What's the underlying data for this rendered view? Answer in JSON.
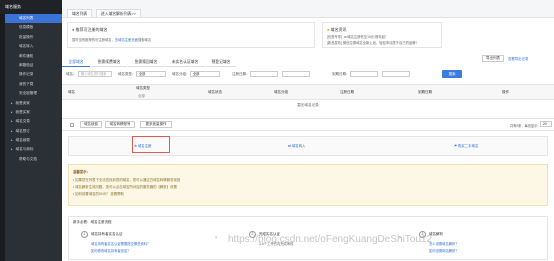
{
  "sidebar": {
    "header": "域名服务",
    "items": [
      {
        "label": "域名列表",
        "active": true
      },
      {
        "label": "信息模板"
      },
      {
        "label": "批量操作"
      },
      {
        "label": "域名转入"
      },
      {
        "label": "邮件通知"
      },
      {
        "label": "邮箱验证"
      },
      {
        "label": "操作记录"
      },
      {
        "label": "我的下载"
      },
      {
        "label": "安全锁管理"
      },
      {
        "label": "我是卖家",
        "section": true
      },
      {
        "label": "我是买家",
        "section": true
      },
      {
        "label": "域名交易",
        "section": true
      },
      {
        "label": "域名预订",
        "section": true
      },
      {
        "label": "域名续费",
        "section": true
      },
      {
        "label": "域名与商标",
        "section": true
      },
      {
        "label": "帮助与文档"
      }
    ]
  },
  "tabs": [
    "域名列表",
    "进入域名解析列表>>"
  ],
  "notice_left": {
    "title": "推荐可注册的域名",
    "text": "暂时没有推荐的可注册域名，",
    "link": "去域名注册页面",
    "suffix": "搜索域名"
  },
  "notice_right": {
    "title": "域名资讯",
    "lines": [
      "[优惠专享] .cn域名注册低至16元/首年起！",
      "[新品发布] 微信位置域名全新上线，轻松申请属于自己的品牌！"
    ]
  },
  "actions": {
    "export": "导出列表",
    "manage": "查看导出记录"
  },
  "content_tabs": [
    "全部域名",
    "急需续费域名",
    "急需赎回域名",
    "未实名认证域名",
    "预登记域名"
  ],
  "filters": {
    "domain_label": "域名：",
    "domain_placeholder": "输入域名进行搜索",
    "type_label": "域名类型：",
    "type_value": "全部",
    "group_label": "域名分组：",
    "group_value": "全部",
    "reg_label": "注册日期：",
    "exp_label": "到期日期：",
    "search_btn": "搜索"
  },
  "table": {
    "headers": [
      "域名",
      "域名类型",
      "域名状态",
      "域名分组",
      "注册日期",
      "到期日期",
      "操作"
    ],
    "sub_header": "全部",
    "empty": "暂无域名记录"
  },
  "bulk": {
    "renew": "域名续费",
    "transfer": "域名转移账号",
    "more": "更多批量操作",
    "pager": "共有0条，每页显示：",
    "page_size": "20"
  },
  "cards": [
    {
      "label": "域名注册",
      "icon": "plus-icon"
    },
    {
      "label": "域名转入",
      "icon": "transfer-icon"
    },
    {
      "label": "购买二手域名",
      "icon": "cart-icon"
    }
  ],
  "help": {
    "title": "温馨提示：",
    "lines": [
      "• 如果您在列表下无法查找到您的域名，您可以通过白域名转移服务找回",
      "• 域名解析生效问题，您可以点击域名所对应的服务器的【解析】设置",
      "• 如何设置域名的DNS？ 查看帮助"
    ]
  },
  "steps": {
    "title": "新手必看：域名注册流程",
    "items": [
      {
        "num": "1",
        "title": "域名持有者实名认证",
        "links": [
          "域名持有者实名认证需要提交哪些资料？",
          "如何修改域名持有者信息？"
        ]
      },
      {
        "num": "2",
        "title": "完成实名认证",
        "links": [
          "3-5个工作日内完成审核"
        ]
      },
      {
        "num": "3",
        "title": "域名解析",
        "links": [
          "怎么设置域名解析？",
          "如何设置网站解析？"
        ]
      }
    ]
  },
  "watermark": "https://blog.csdn.net/oFengKuangDeShiTou12"
}
